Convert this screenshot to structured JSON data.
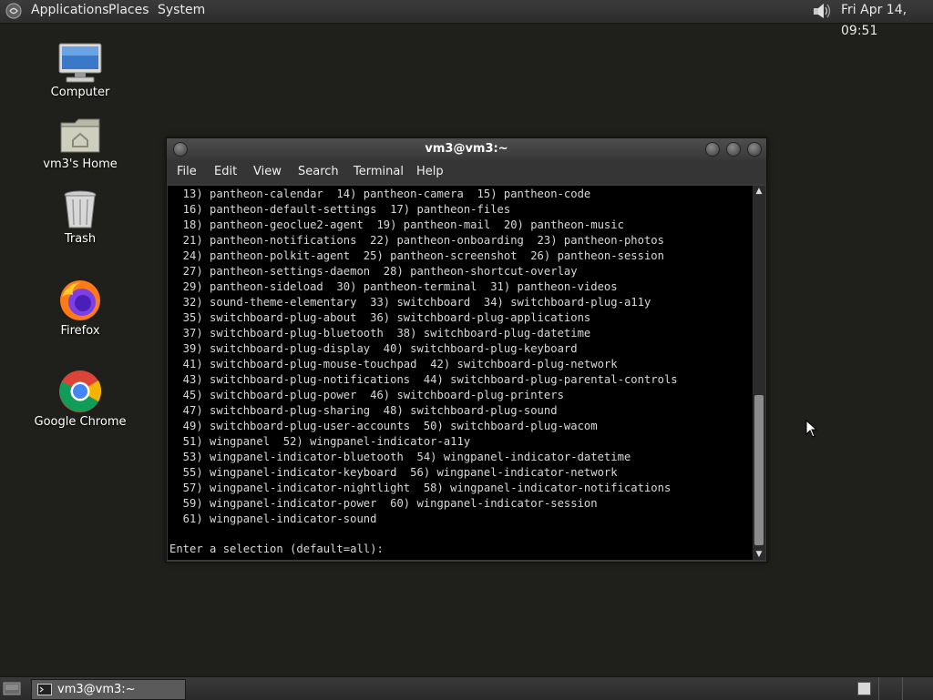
{
  "top_panel": {
    "menus": [
      "Applications",
      "Places",
      "System"
    ],
    "clock": "Fri Apr 14, 09:51"
  },
  "desktop_icons": [
    {
      "label": "Computer",
      "icon": "computer-icon"
    },
    {
      "label": "vm3's Home",
      "icon": "home-folder-icon"
    },
    {
      "label": "Trash",
      "icon": "trash-icon"
    },
    {
      "label": "Firefox",
      "icon": "firefox-icon"
    },
    {
      "label": "Google Chrome",
      "icon": "chrome-icon"
    }
  ],
  "terminal": {
    "title": "vm3@vm3:~",
    "menu": [
      "File",
      "Edit",
      "View",
      "Search",
      "Terminal",
      "Help"
    ],
    "lines": [
      "  13) pantheon-calendar  14) pantheon-camera  15) pantheon-code",
      "  16) pantheon-default-settings  17) pantheon-files",
      "  18) pantheon-geoclue2-agent  19) pantheon-mail  20) pantheon-music",
      "  21) pantheon-notifications  22) pantheon-onboarding  23) pantheon-photos",
      "  24) pantheon-polkit-agent  25) pantheon-screenshot  26) pantheon-session",
      "  27) pantheon-settings-daemon  28) pantheon-shortcut-overlay",
      "  29) pantheon-sideload  30) pantheon-terminal  31) pantheon-videos",
      "  32) sound-theme-elementary  33) switchboard  34) switchboard-plug-a11y",
      "  35) switchboard-plug-about  36) switchboard-plug-applications",
      "  37) switchboard-plug-bluetooth  38) switchboard-plug-datetime",
      "  39) switchboard-plug-display  40) switchboard-plug-keyboard",
      "  41) switchboard-plug-mouse-touchpad  42) switchboard-plug-network",
      "  43) switchboard-plug-notifications  44) switchboard-plug-parental-controls",
      "  45) switchboard-plug-power  46) switchboard-plug-printers",
      "  47) switchboard-plug-sharing  48) switchboard-plug-sound",
      "  49) switchboard-plug-user-accounts  50) switchboard-plug-wacom",
      "  51) wingpanel  52) wingpanel-indicator-a11y",
      "  53) wingpanel-indicator-bluetooth  54) wingpanel-indicator-datetime",
      "  55) wingpanel-indicator-keyboard  56) wingpanel-indicator-network",
      "  57) wingpanel-indicator-nightlight  58) wingpanel-indicator-notifications",
      "  59) wingpanel-indicator-power  60) wingpanel-indicator-session",
      "  61) wingpanel-indicator-sound"
    ],
    "prompt": "Enter a selection (default=all): "
  },
  "taskbar": {
    "window_button_label": "vm3@vm3:~"
  },
  "colors": {
    "desktop_bg": "#1f201c",
    "terminal_bg": "#000000",
    "terminal_fg": "#d8d8d8"
  }
}
